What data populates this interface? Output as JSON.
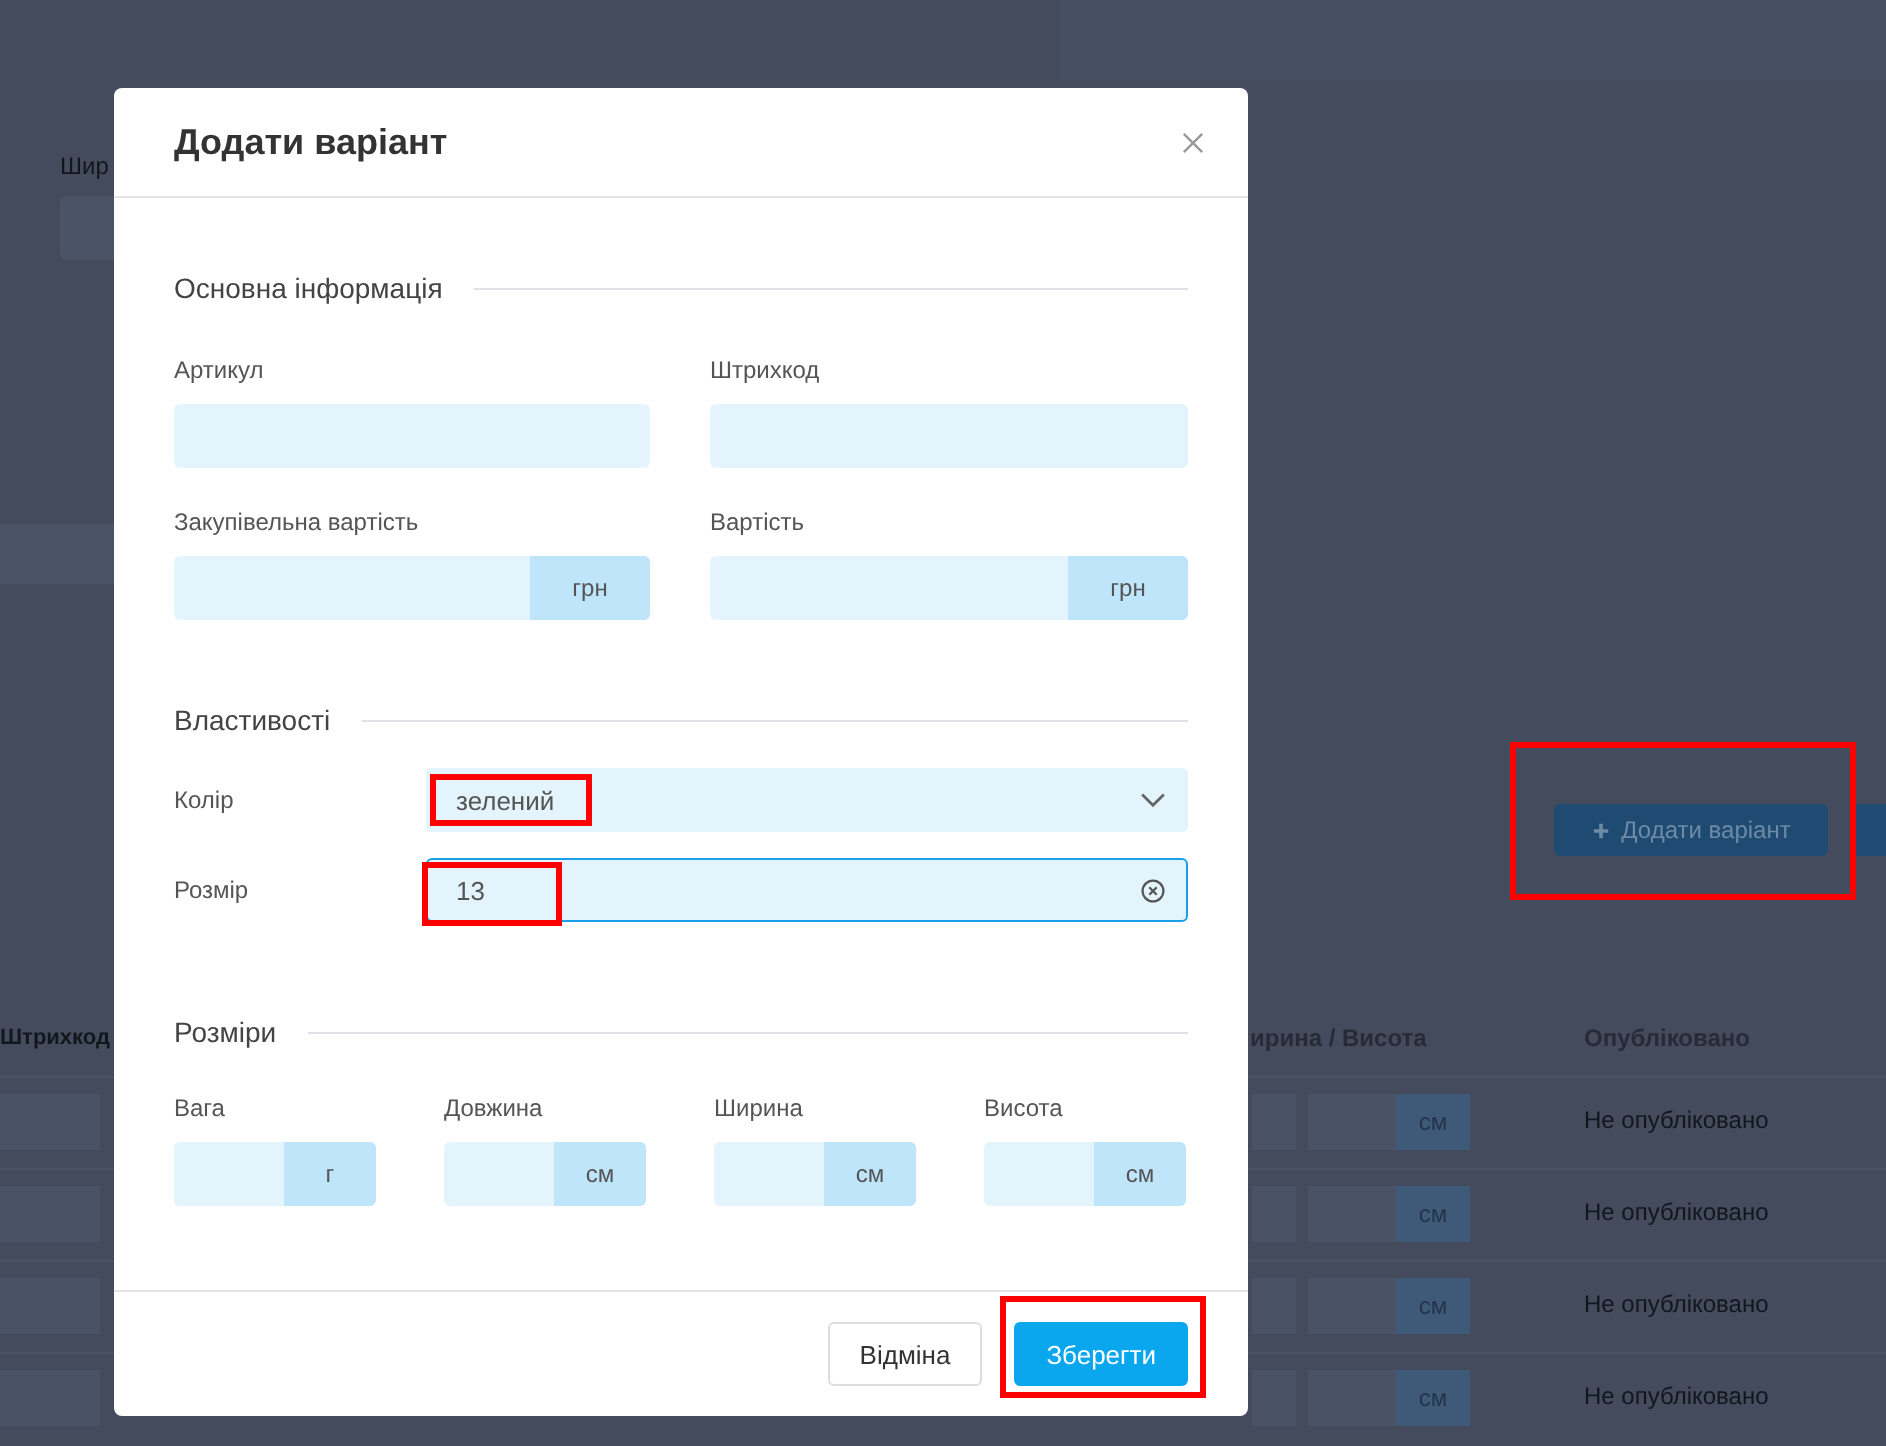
{
  "background": {
    "width_label": "Шир",
    "add_variant_button": "Додати варіант",
    "table": {
      "columns": [
        "Штрихкод",
        "ирина / Висота",
        "Опубліковано"
      ],
      "rows": [
        {
          "unit": "см",
          "status": "Не опубліковано"
        },
        {
          "unit": "см",
          "status": "Не опубліковано"
        },
        {
          "unit": "см",
          "status": "Не опубліковано"
        },
        {
          "unit": "см",
          "status": "Не опубліковано"
        }
      ]
    }
  },
  "dialog": {
    "title": "Додати варіант",
    "basic": {
      "title": "Основна інформація",
      "fields": [
        {
          "label": "Артикул"
        },
        {
          "label": "Штрихкод"
        },
        {
          "label": "Закупівельна вартість",
          "unit": "грн"
        },
        {
          "label": "Вартість",
          "unit": "грн"
        }
      ]
    },
    "properties": {
      "title": "Властивості",
      "rows": [
        {
          "label": "Колір",
          "kind": "select",
          "value": "зелений",
          "focused": false
        },
        {
          "label": "Розмір",
          "kind": "text",
          "value": "13",
          "focused": true
        }
      ]
    },
    "dimensions": {
      "title": "Розміри",
      "fields": [
        {
          "label": "Вага",
          "unit": "г"
        },
        {
          "label": "Довжина",
          "unit": "см"
        },
        {
          "label": "Ширина",
          "unit": "см"
        },
        {
          "label": "Висота",
          "unit": "см"
        }
      ]
    },
    "buttons": {
      "cancel": "Відміна",
      "save": "Зберегти"
    }
  }
}
